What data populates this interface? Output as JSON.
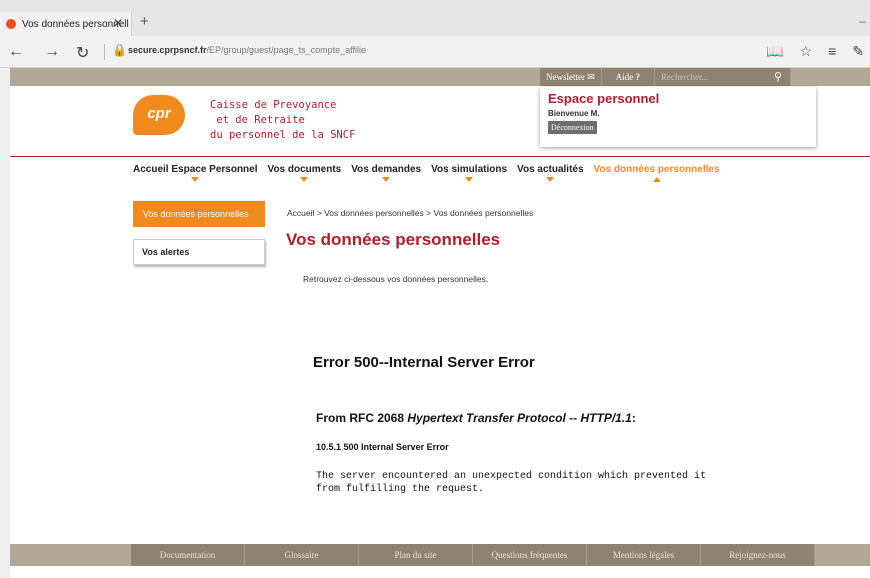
{
  "browser": {
    "tab_title": "Vos données personnell",
    "tab_close": "✕",
    "new_tab": "+",
    "url_domain": "secure.cprpsncf.fr",
    "url_path": "/EP/group/guest/page_ts_compte_affilie"
  },
  "topnav": {
    "newsletter": "Newsletter",
    "aide": "Aide",
    "search_placeholder": "Rechercher..."
  },
  "brand": {
    "logo_text": "cpr",
    "line1": "Caisse de Prevoyance",
    "line2": " et de Retraite",
    "line3": "du personnel de la SNCF"
  },
  "espace": {
    "title": "Espace personnel",
    "welcome": "Bienvenue M.",
    "logout": "Déconnexion"
  },
  "mainnav": [
    {
      "label": "Accueil Espace Personnel"
    },
    {
      "label": "Vos documents"
    },
    {
      "label": "Vos demandes"
    },
    {
      "label": "Vos simulations"
    },
    {
      "label": "Vos actualités"
    },
    {
      "label": "Vos données personnelles"
    }
  ],
  "sidebar": {
    "item1": "Vos données personnelles",
    "item2": "Vos alertes"
  },
  "content": {
    "breadcrumb": "Accueil > Vos données personnelles > Vos données personnelles",
    "title": "Vos données personnelles",
    "intro": "Retrouvez ci-dessous vos données personnelles."
  },
  "error": {
    "heading": "Error 500--Internal Server Error",
    "rfc_prefix": "From RFC 2068 ",
    "rfc_italic": "Hypertext Transfer Protocol -- HTTP/1.1",
    "rfc_suffix": ":",
    "code": "10.5.1 500 Internal Server Error",
    "line1": "The server encountered an unexpected condition which prevented it",
    "line2": "from fulfilling the request."
  },
  "footer": [
    {
      "label": "Documentation"
    },
    {
      "label": "Glossaire"
    },
    {
      "label": "Plan du site"
    },
    {
      "label": "Questions fréquentes"
    },
    {
      "label": "Mentions légales"
    },
    {
      "label": "Rejoignez-nous"
    }
  ]
}
